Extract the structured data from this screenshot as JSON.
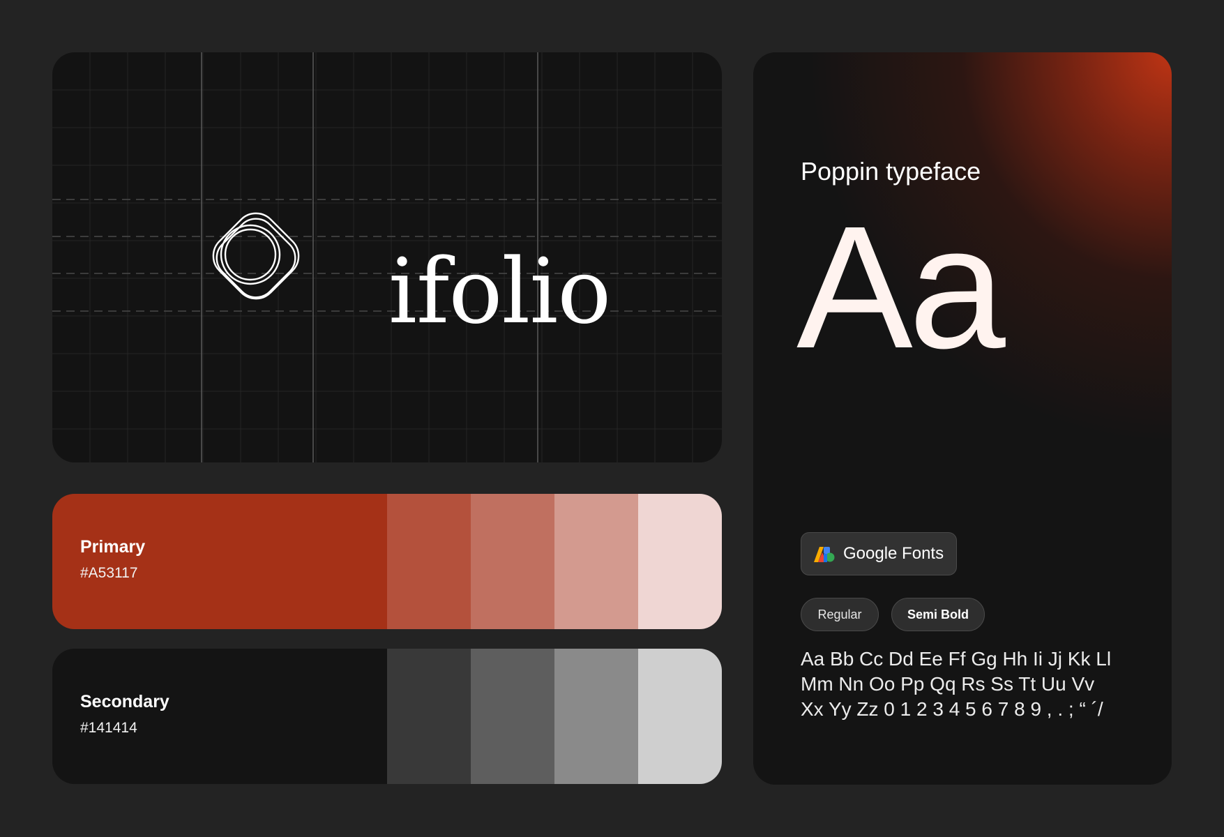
{
  "logo": {
    "wordmark": "ifolio",
    "icon": "concentric-rings-rounded-diamond-icon"
  },
  "palette": {
    "primary": {
      "name": "Primary",
      "hex": "#A53117",
      "shades": [
        "#B4513C",
        "#C07060",
        "#D39A8F",
        "#EFD6D3"
      ]
    },
    "secondary": {
      "name": "Secondary",
      "hex": "#141414",
      "shades": [
        "#393939",
        "#5E5E5E",
        "#8A8A8A",
        "#CFCFCF"
      ]
    }
  },
  "typography": {
    "title": "Poppin typeface",
    "specimen": "Aa",
    "source_button": "Google Fonts",
    "source_icon": "google-fonts-icon",
    "weights": [
      "Regular",
      "Semi Bold"
    ],
    "charset_lines": [
      "Aa Bb Cc Dd Ee Ff Gg Hh Ii Jj Kk Ll",
      "Mm Nn Oo Pp Qq Rs Ss Tt Uu Vv",
      "Xx Yy Zz 0 1 2 3 4 5 6 7 8 9 , . ; “ ´/"
    ]
  }
}
